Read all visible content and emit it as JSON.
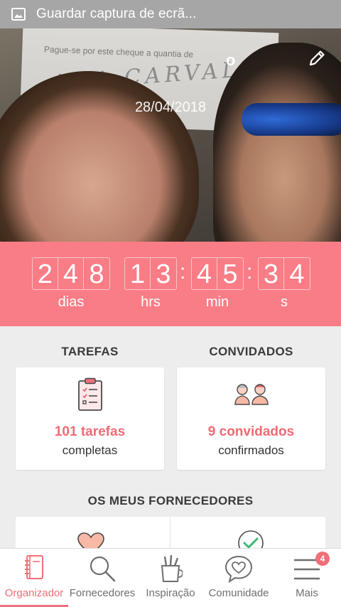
{
  "statusbar": {
    "title": "Guardar captura de ecrã...",
    "icon": "image-icon"
  },
  "hero": {
    "couple_name": "o",
    "date": "28/04/2018",
    "photo_text_line1": "Pague-se por este cheque a quantia de",
    "photo_text_line2": "ANA CARVALHO",
    "edit_icon": "pencil-icon"
  },
  "countdown": {
    "days": [
      "2",
      "4",
      "8"
    ],
    "hours": [
      "1",
      "3"
    ],
    "minutes": [
      "4",
      "5"
    ],
    "seconds": [
      "3",
      "4"
    ],
    "separator": ":",
    "labels": {
      "days": "dias",
      "hours": "hrs",
      "minutes": "min",
      "seconds": "s"
    }
  },
  "tasks": {
    "title": "TAREFAS",
    "count": "101 tarefas",
    "sub": "completas",
    "icon": "clipboard-icon"
  },
  "guests": {
    "title": "CONVIDADOS",
    "count": "9 convidados",
    "sub": "confirmados",
    "icon": "guests-icon"
  },
  "suppliers": {
    "title": "OS MEUS FORNECEDORES",
    "icons": [
      "heart-icon",
      "check-circle-icon"
    ]
  },
  "nav": {
    "items": [
      {
        "label": "Organizador",
        "icon": "notebook-icon"
      },
      {
        "label": "Fornecedores",
        "icon": "search-icon"
      },
      {
        "label": "Inspiração",
        "icon": "pencil-cup-icon"
      },
      {
        "label": "Comunidade",
        "icon": "chat-heart-icon"
      },
      {
        "label": "Mais",
        "icon": "menu-icon"
      }
    ],
    "badge": "4"
  },
  "colors": {
    "accent": "#f97d86",
    "accent_text": "#ef6b75",
    "statusbar": "#a6a6a6",
    "background": "#ededed"
  }
}
